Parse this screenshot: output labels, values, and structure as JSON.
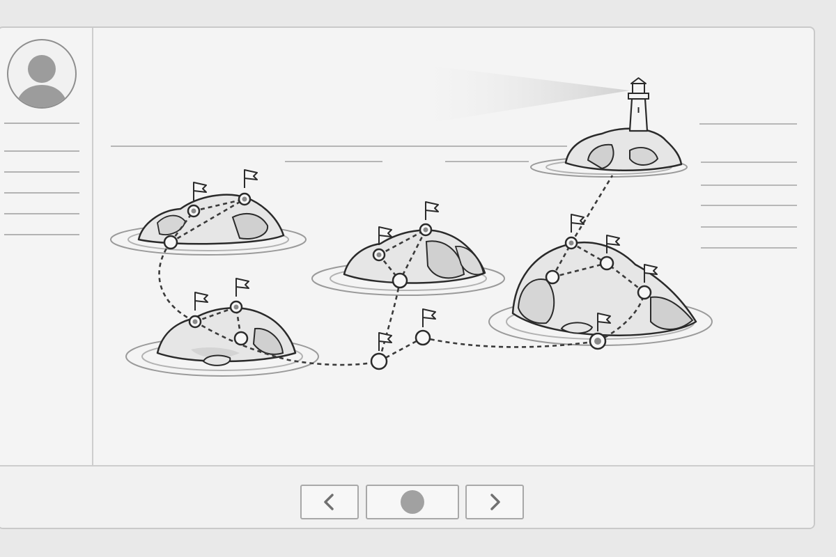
{
  "window": {
    "name": "island-map-window"
  },
  "sidebar": {
    "avatar": {
      "icon": "user-avatar-icon"
    },
    "lines": 6
  },
  "map": {
    "islands": 5,
    "lighthouse": {
      "icon": "lighthouse-icon"
    },
    "flag_icon": "flag-icon",
    "node_icon": "waypoint-icon"
  },
  "footer": {
    "prev": {
      "icon": "chevron-left-icon"
    },
    "center": {
      "icon": "record-dot-icon"
    },
    "next": {
      "icon": "chevron-right-icon"
    }
  },
  "colors": {
    "background": "#e9e9e9",
    "panel": "#f4f4f4",
    "ink": "#2a2a2a",
    "rock_fill": "#e6e6e6",
    "rock_shade": "#cfcfcf"
  }
}
